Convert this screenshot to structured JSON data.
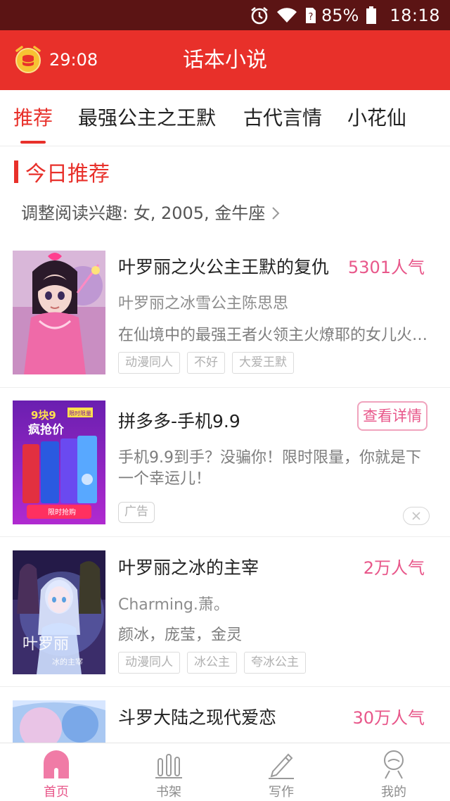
{
  "status_bar": {
    "battery": "85%",
    "time": "18:18"
  },
  "header": {
    "timer": "29:08",
    "title": "话本小说"
  },
  "tabs": [
    {
      "label": "推荐",
      "active": true
    },
    {
      "label": "最强公主之王默",
      "active": false
    },
    {
      "label": "古代言情",
      "active": false
    },
    {
      "label": "小花仙",
      "active": false
    }
  ],
  "section": {
    "title": "今日推荐",
    "interest": "调整阅读兴趣: 女, 2005, 金牛座"
  },
  "books": [
    {
      "title": "叶罗丽之火公主王默的复仇",
      "popularity": "5301人气",
      "author": "叶罗丽之冰雪公主陈思思",
      "description": "在仙境中的最强王者火领主火燎耶的女儿火公主王默的复仇",
      "tags": [
        "动漫同人",
        "不好",
        "大爱王默"
      ]
    },
    {
      "title": "叶罗丽之冰的主宰",
      "popularity": "2万人气",
      "author": "Charming.萧。",
      "description": "颜冰，庞莹，金灵",
      "tags": [
        "动漫同人",
        "冰公主",
        "夸冰公主"
      ]
    },
    {
      "title": "斗罗大陆之现代爱恋",
      "popularity": "30万人气"
    }
  ],
  "ad": {
    "title": "拼多多-手机9.9",
    "detail_label": "查看详情",
    "description": "手机9.9到手？没骗你！限时限量，你就是下一个幸运儿！",
    "badge": "广告",
    "image": {
      "price": "9块9",
      "flag": "限时限量",
      "headline": "疯抢价",
      "button": "限时抢购"
    }
  },
  "bottom_nav": [
    {
      "label": "首页",
      "icon": "home-icon",
      "active": true
    },
    {
      "label": "书架",
      "icon": "bookshelf-icon",
      "active": false
    },
    {
      "label": "写作",
      "icon": "pen-icon",
      "active": false
    },
    {
      "label": "我的",
      "icon": "profile-icon",
      "active": false
    }
  ],
  "colors": {
    "status_bar": "#5b1414",
    "brand_red": "#e8302a",
    "accent_pink": "#e8578a",
    "text_main": "#222222",
    "text_muted": "#8c8c8c"
  }
}
